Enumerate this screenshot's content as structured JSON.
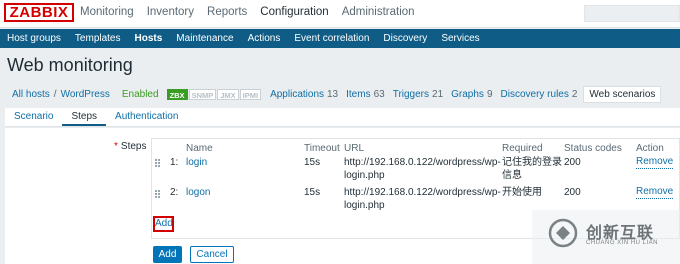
{
  "logo": "ZABBIX",
  "main_menu": [
    "Monitoring",
    "Inventory",
    "Reports",
    "Configuration",
    "Administration"
  ],
  "sub_menu": [
    "Host groups",
    "Templates",
    "Hosts",
    "Maintenance",
    "Actions",
    "Event correlation",
    "Discovery",
    "Services"
  ],
  "page_title": "Web monitoring",
  "host_nav": {
    "all_hosts": "All hosts",
    "separator": "/",
    "host": "WordPress",
    "status": "Enabled",
    "availability": [
      "ZBX",
      "SNMP",
      "JMX",
      "IPMI"
    ],
    "items": [
      {
        "label": "Applications",
        "count": "13"
      },
      {
        "label": "Items",
        "count": "63"
      },
      {
        "label": "Triggers",
        "count": "21"
      },
      {
        "label": "Graphs",
        "count": "9"
      },
      {
        "label": "Discovery rules",
        "count": "2"
      }
    ],
    "current": "Web scenarios"
  },
  "tabs": [
    "Scenario",
    "Steps",
    "Authentication"
  ],
  "steps": {
    "label": "Steps",
    "required_mark": "*",
    "columns": [
      "Name",
      "Timeout",
      "URL",
      "Required",
      "Status codes",
      "Action"
    ],
    "rows": [
      {
        "num": "1:",
        "name": "login",
        "timeout": "15s",
        "url_line1": "http://192.168.0.122/wordpress/wp-",
        "url_line2": "login.php",
        "required_line1": "记住我的登录",
        "required_line2": "信息",
        "status_codes": "200",
        "action": "Remove"
      },
      {
        "num": "2:",
        "name": "logon",
        "timeout": "15s",
        "url_line1": "http://192.168.0.122/wordpress/wp-",
        "url_line2": "login.php",
        "required_line1": "开始使用",
        "required_line2": "",
        "status_codes": "200",
        "action": "Remove"
      }
    ],
    "add_link": "Add"
  },
  "buttons": {
    "add": "Add",
    "cancel": "Cancel"
  },
  "watermark": {
    "cn": "创新互联",
    "en": "CHUANG XIN HU LIAN"
  },
  "colors": {
    "brand_red": "#d40000",
    "nav_blue": "#0f5d86",
    "link_blue": "#0f6fa6",
    "enabled_green": "#3a9d23"
  }
}
